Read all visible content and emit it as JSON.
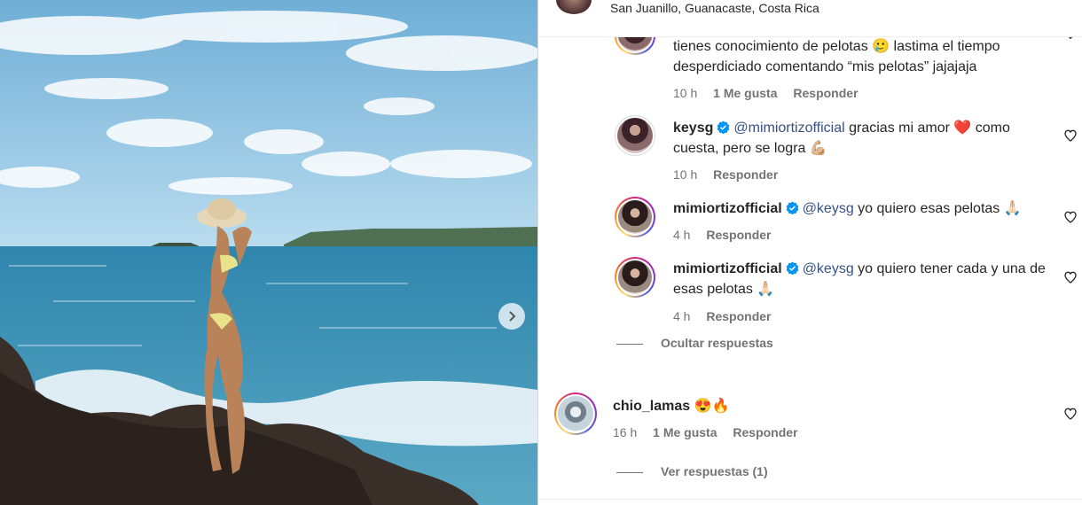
{
  "post": {
    "location": "San Juanillo, Guanacaste, Costa Rica"
  },
  "photo": {
    "next_icon": "chevron-right-icon",
    "colors": {
      "sky": "#8fc3e2",
      "sea": "#3d93b7",
      "rock": "#3a2e28"
    }
  },
  "comments": [
    {
      "text": "tienes conocimiento de pelotas 🥲 lastima el tiempo desperdiciado comentando “mis pelotas” jajajaja",
      "time": "10 h",
      "likes": "1 Me gusta",
      "reply_label": "Responder"
    },
    {
      "username": "keysg",
      "mention": "@mimiortizofficial",
      "text": " gracias mi amor ❤️ como cuesta, pero se logra 💪🏼",
      "time": "10 h",
      "reply_label": "Responder"
    },
    {
      "username": "mimiortizofficial",
      "mention": "@keysg",
      "text": " yo quiero esas pelotas 🙏🏻",
      "time": "4 h",
      "reply_label": "Responder"
    },
    {
      "username": "mimiortizofficial",
      "mention": "@keysg",
      "text": " yo quiero tener cada y una de esas pelotas 🙏🏻",
      "time": "4 h",
      "reply_label": "Responder"
    }
  ],
  "hide_replies_label": "Ocultar respuestas",
  "top_comment": {
    "username": "chio_lamas",
    "text": "😍🔥",
    "time": "16 h",
    "likes": "1 Me gusta",
    "reply_label": "Responder"
  },
  "view_replies_label": "Ver respuestas (1)",
  "accent": {
    "mention": "#385185",
    "verified": "#0095f6",
    "muted": "#737373"
  }
}
